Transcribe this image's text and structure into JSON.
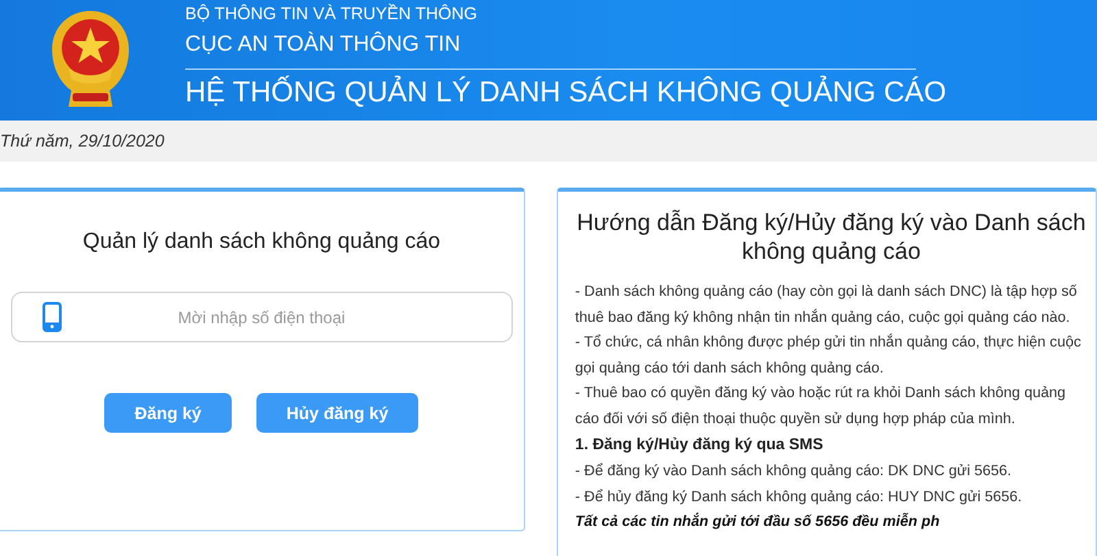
{
  "header": {
    "ministry": "BỘ THÔNG TIN VÀ TRUYỀN THÔNG",
    "department": "CỤC AN TOÀN THÔNG TIN",
    "system_title": "HỆ THỐNG QUẢN LÝ DANH SÁCH KHÔNG QUẢNG CÁO"
  },
  "date": "Thứ năm, 29/10/2020",
  "manage_card": {
    "title": "Quản lý danh sách không quảng cáo",
    "phone_field": {
      "placeholder": "Mời nhập số điện thoại"
    },
    "buttons": [
      "Đăng ký",
      "Hủy đăng ký"
    ]
  },
  "guide_card": {
    "title": "Hướng dẫn Đăng ký/Hủy đăng ký vào Danh sách không quảng cáo",
    "paragraphs": [
      "- Danh sách không quảng cáo (hay còn gọi là danh sách DNC) là tập hợp số thuê bao đăng ký không nhận tin nhắn quảng cáo, cuộc gọi quảng cáo nào.",
      "- Tổ chức, cá nhân không được phép gửi tin nhắn quảng cáo, thực hiện cuộc gọi quảng cáo tới danh sách không quảng cáo.",
      "- Thuê bao có quyền đăng ký vào hoặc rút ra khỏi Danh sách không quảng cáo đối với số điện thoại thuộc quyền sử dụng hợp pháp của mình."
    ],
    "section_heading": "1. Đăng ký/Hủy đăng ký qua SMS",
    "sms_steps": [
      "- Để đăng ký vào Danh sách không quảng cáo: DK DNC gửi 5656.",
      "- Để hủy đăng ký Danh sách không quảng cáo: HUY DNC gửi 5656."
    ],
    "note": "Tất cả các tin nhắn gửi tới đầu số 5656 đều miễn ph"
  }
}
